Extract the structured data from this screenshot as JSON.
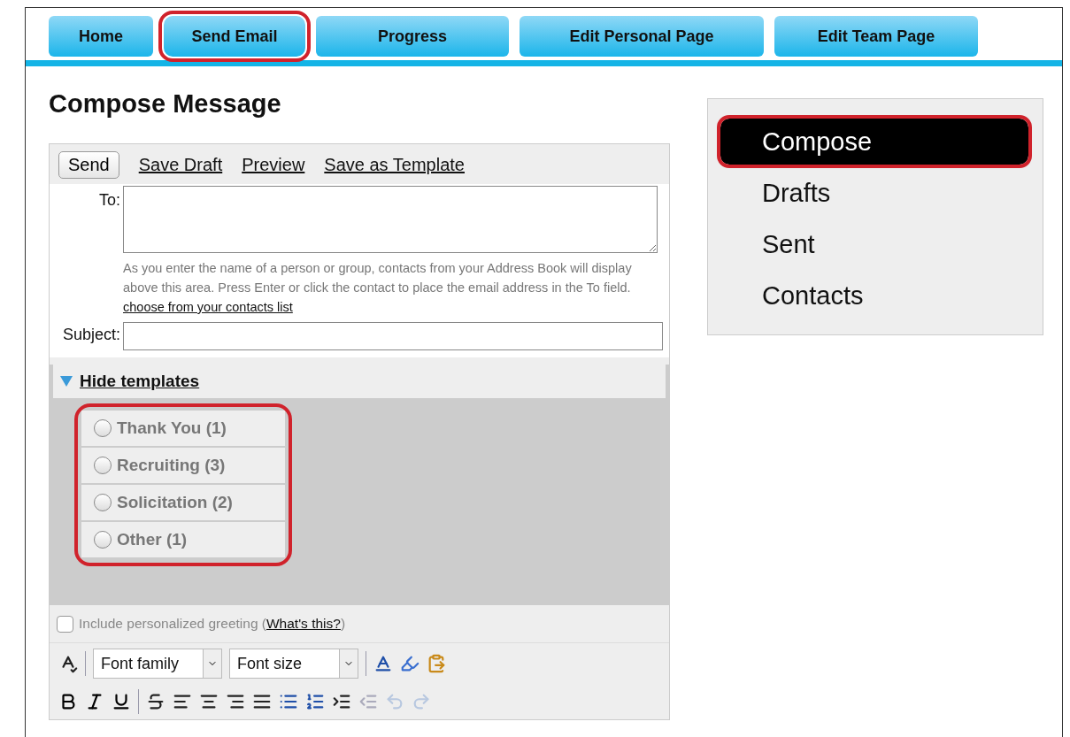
{
  "nav_tabs": [
    {
      "label": "Home",
      "highlighted": false
    },
    {
      "label": "Send Email",
      "highlighted": true
    },
    {
      "label": "Progress",
      "highlighted": false
    },
    {
      "label": "Edit Personal Page",
      "highlighted": false
    },
    {
      "label": "Edit Team Page",
      "highlighted": false
    }
  ],
  "page_title": "Compose Message",
  "actions": {
    "send": "Send",
    "links": [
      "Save Draft",
      "Preview",
      "Save as Template"
    ]
  },
  "to": {
    "label": "To:",
    "help": "As you enter the name of a person or group, contacts from your Address Book will display above this area. Press Enter or click the contact to place the email address in the To field.",
    "help_link": "choose from your contacts list"
  },
  "subject": {
    "label": "Subject:"
  },
  "templates": {
    "toggle": "Hide templates",
    "expanded": true,
    "highlighted": true,
    "items": [
      {
        "label": "Thank You (1)",
        "selected": false
      },
      {
        "label": "Recruiting (3)",
        "selected": false
      },
      {
        "label": "Solicitation (2)",
        "selected": false
      },
      {
        "label": "Other (1)",
        "selected": false
      }
    ]
  },
  "greeting": {
    "label": "Include personalized greeting (",
    "link": "What's this?",
    "close": ")",
    "checked": false
  },
  "editor": {
    "font_family": "Font family",
    "font_size": "Font size"
  },
  "sidebar": {
    "items": [
      {
        "label": "Compose",
        "selected": true,
        "highlighted": true
      },
      {
        "label": "Drafts",
        "selected": false,
        "highlighted": false
      },
      {
        "label": "Sent",
        "selected": false,
        "highlighted": false
      },
      {
        "label": "Contacts",
        "selected": false,
        "highlighted": false
      }
    ]
  }
}
